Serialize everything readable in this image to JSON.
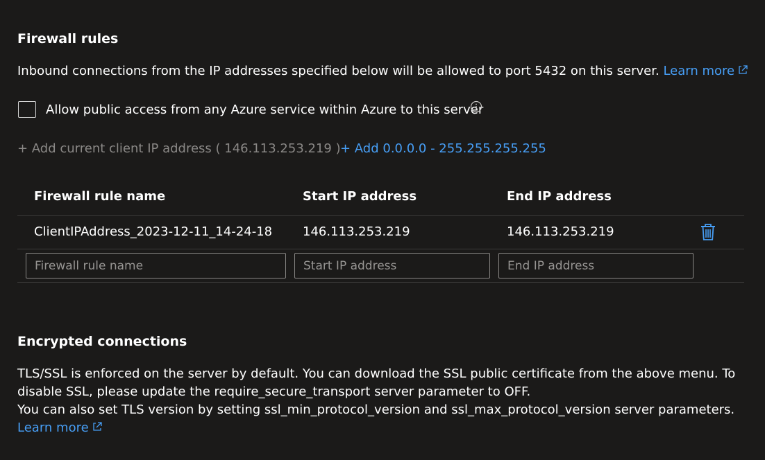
{
  "firewall": {
    "heading": "Firewall rules",
    "description": "Inbound connections from the IP addresses specified below will be allowed to port 5432 on this server.",
    "learn_more": "Learn more",
    "allow_azure_label": "Allow public access from any Azure service within Azure to this server",
    "add_client_ip": "+ Add current client IP address ( 146.113.253.219 )",
    "add_all_ips": "+ Add 0.0.0.0 - 255.255.255.255",
    "table": {
      "headers": [
        "Firewall rule name",
        "Start IP address",
        "End IP address"
      ],
      "rows": [
        {
          "name": "ClientIPAddress_2023-12-11_14-24-18",
          "start": "146.113.253.219",
          "end": "146.113.253.219"
        }
      ],
      "new_row": {
        "name_placeholder": "Firewall rule name",
        "start_placeholder": "Start IP address",
        "end_placeholder": "End IP address"
      }
    }
  },
  "encrypted": {
    "heading": "Encrypted connections",
    "line1": "TLS/SSL is enforced on the server by default. You can download the SSL public certificate from the above menu. To disable SSL, please update the require_secure_transport server parameter to OFF.",
    "line2": "You can also set TLS version by setting ssl_min_protocol_version and ssl_max_protocol_version server parameters.",
    "learn_more": "Learn more"
  },
  "colors": {
    "background": "#1b1a19",
    "link": "#479ef5",
    "disabled_text": "#8a8886",
    "divider": "#3b3a39"
  }
}
